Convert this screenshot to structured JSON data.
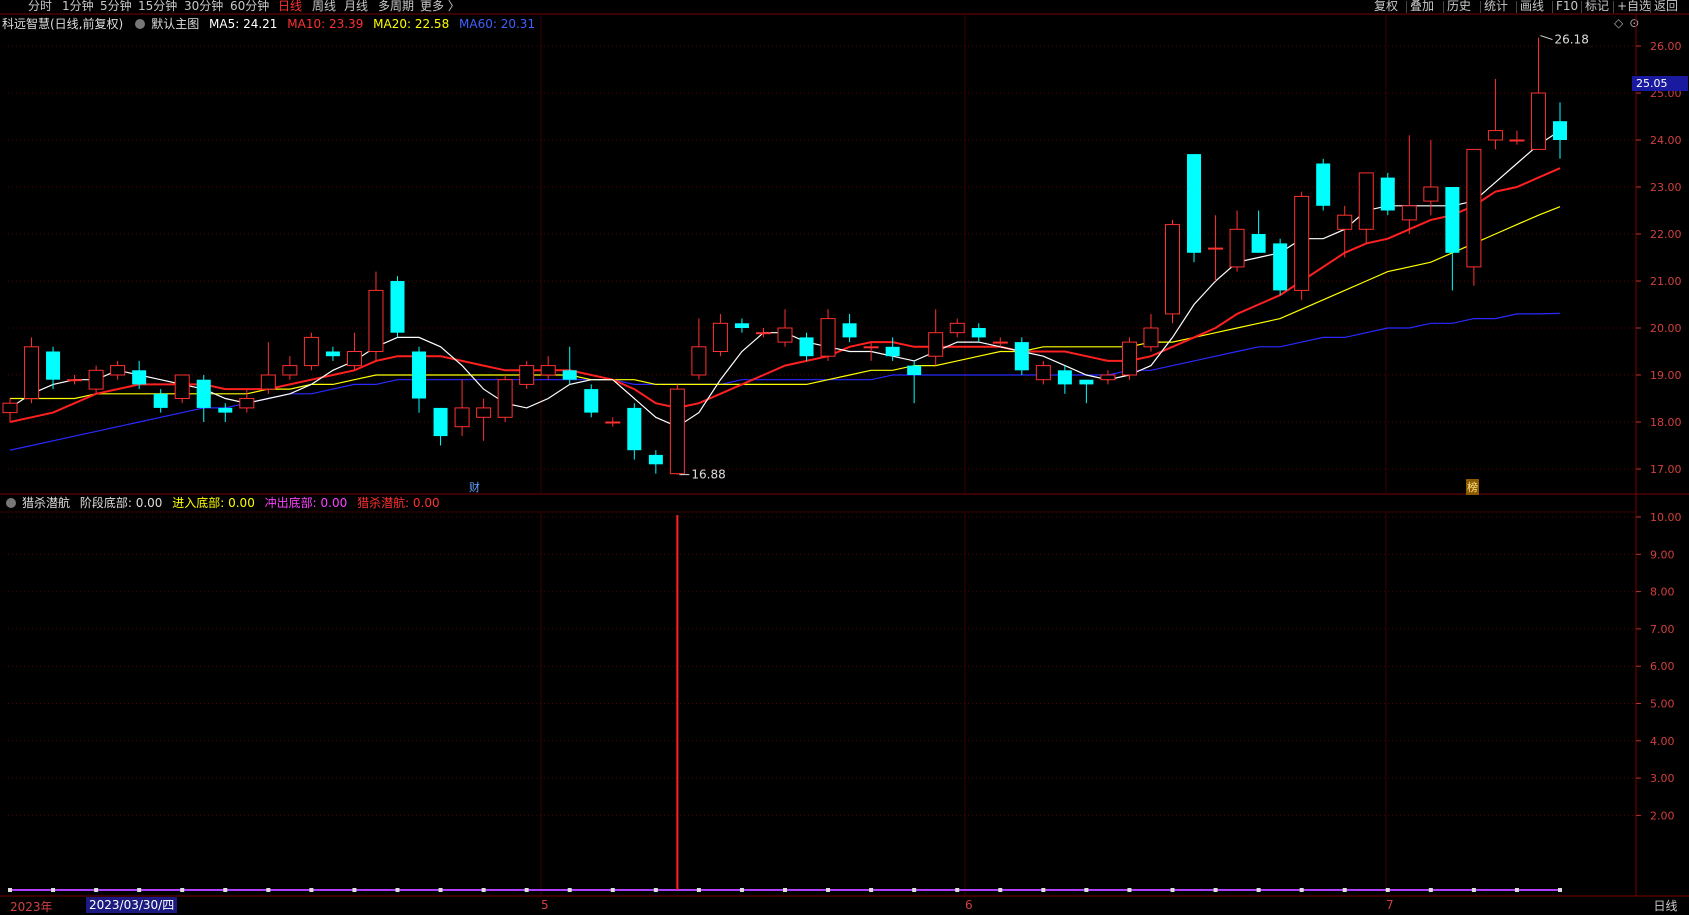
{
  "periods": [
    "分时",
    "1分钟",
    "5分钟",
    "15分钟",
    "30分钟",
    "60分钟",
    "日线",
    "周线",
    "月线",
    "多周期",
    "更多 〉"
  ],
  "active_period": "日线",
  "toolbar": [
    "复权",
    "叠加",
    "历史",
    "统计",
    "画线",
    "F10",
    "标记",
    "+自选",
    "返回"
  ],
  "window_icons": [
    "◇",
    "⊙"
  ],
  "main_legend": {
    "stock": "科远智慧(日线,前复权)",
    "template": "默认主图",
    "ma5": "MA5: 24.21",
    "ma10": "MA10: 23.39",
    "ma20": "MA20: 22.58",
    "ma60": "MA60: 20.31"
  },
  "sub_legend": {
    "name": "猎杀潜航",
    "stage": "阶段底部: 0.00",
    "enter": "进入底部: 0.00",
    "out": "冲出底部: 0.00",
    "hunt": "猎杀潜航: 0.00"
  },
  "current_price": "25.05",
  "high_label": "26.18",
  "low_label": "16.88",
  "markers": {
    "cai": "财",
    "bang": "榜"
  },
  "dates": {
    "year": "2023年",
    "selected": "2023/03/30/四",
    "m5": "5",
    "m6": "6",
    "m7": "7"
  },
  "bottom_tab": "日线",
  "colors": {
    "up": "#ff3030",
    "down": "#00ffff",
    "ma5": "#ffffff",
    "ma10": "#ff2020",
    "ma20": "#ffff00",
    "ma60": "#2a2aff",
    "grid": "#7a0000",
    "purple": "#b040ff"
  },
  "chart_data": {
    "type": "candlestick",
    "price_axis": {
      "ticks": [
        "26.00",
        "25.00",
        "24.00",
        "23.00",
        "22.00",
        "21.00",
        "20.00",
        "19.00",
        "18.00",
        "17.00"
      ]
    },
    "indicator_axis": {
      "ticks": [
        "10.00",
        "9.00",
        "8.00",
        "7.00",
        "6.00",
        "5.00",
        "4.00",
        "3.00",
        "2.00"
      ]
    },
    "candles": [
      {
        "o": 18.2,
        "h": 18.5,
        "l": 18.0,
        "c": 18.4
      },
      {
        "o": 18.5,
        "h": 19.8,
        "l": 18.4,
        "c": 19.6
      },
      {
        "o": 19.5,
        "h": 19.6,
        "l": 18.7,
        "c": 18.9
      },
      {
        "o": 18.9,
        "h": 19.0,
        "l": 18.8,
        "c": 18.9
      },
      {
        "o": 18.7,
        "h": 19.2,
        "l": 18.6,
        "c": 19.1
      },
      {
        "o": 19.0,
        "h": 19.3,
        "l": 18.9,
        "c": 19.2
      },
      {
        "o": 19.1,
        "h": 19.3,
        "l": 18.7,
        "c": 18.8
      },
      {
        "o": 18.6,
        "h": 18.7,
        "l": 18.2,
        "c": 18.3
      },
      {
        "o": 18.5,
        "h": 19.0,
        "l": 18.4,
        "c": 19.0
      },
      {
        "o": 18.9,
        "h": 19.0,
        "l": 18.0,
        "c": 18.3
      },
      {
        "o": 18.3,
        "h": 18.4,
        "l": 18.0,
        "c": 18.2
      },
      {
        "o": 18.3,
        "h": 18.7,
        "l": 18.2,
        "c": 18.5
      },
      {
        "o": 18.7,
        "h": 19.7,
        "l": 18.6,
        "c": 19.0
      },
      {
        "o": 19.0,
        "h": 19.4,
        "l": 18.9,
        "c": 19.2
      },
      {
        "o": 19.2,
        "h": 19.9,
        "l": 19.1,
        "c": 19.8
      },
      {
        "o": 19.5,
        "h": 19.6,
        "l": 19.3,
        "c": 19.4
      },
      {
        "o": 19.2,
        "h": 19.9,
        "l": 19.1,
        "c": 19.5
      },
      {
        "o": 19.5,
        "h": 21.2,
        "l": 19.3,
        "c": 20.8
      },
      {
        "o": 21.0,
        "h": 21.1,
        "l": 19.8,
        "c": 19.9
      },
      {
        "o": 19.5,
        "h": 19.6,
        "l": 18.2,
        "c": 18.5
      },
      {
        "o": 18.3,
        "h": 18.3,
        "l": 17.5,
        "c": 17.7
      },
      {
        "o": 17.9,
        "h": 18.9,
        "l": 17.7,
        "c": 18.3
      },
      {
        "o": 18.1,
        "h": 18.5,
        "l": 17.6,
        "c": 18.3
      },
      {
        "o": 18.1,
        "h": 19.0,
        "l": 18.0,
        "c": 18.9
      },
      {
        "o": 18.8,
        "h": 19.3,
        "l": 18.7,
        "c": 19.2
      },
      {
        "o": 19.0,
        "h": 19.4,
        "l": 18.9,
        "c": 19.2
      },
      {
        "o": 19.1,
        "h": 19.6,
        "l": 18.8,
        "c": 18.9
      },
      {
        "o": 18.7,
        "h": 18.8,
        "l": 18.1,
        "c": 18.2
      },
      {
        "o": 18.0,
        "h": 18.1,
        "l": 17.9,
        "c": 18.0
      },
      {
        "o": 18.3,
        "h": 18.4,
        "l": 17.2,
        "c": 17.4
      },
      {
        "o": 17.3,
        "h": 17.4,
        "l": 16.9,
        "c": 17.1
      },
      {
        "o": 16.9,
        "h": 18.8,
        "l": 16.88,
        "c": 18.7
      },
      {
        "o": 19.0,
        "h": 20.2,
        "l": 18.9,
        "c": 19.6
      },
      {
        "o": 19.5,
        "h": 20.3,
        "l": 19.4,
        "c": 20.1
      },
      {
        "o": 20.1,
        "h": 20.2,
        "l": 19.9,
        "c": 20.0
      },
      {
        "o": 19.9,
        "h": 20.0,
        "l": 19.8,
        "c": 19.9
      },
      {
        "o": 19.7,
        "h": 20.4,
        "l": 19.6,
        "c": 20.0
      },
      {
        "o": 19.8,
        "h": 19.9,
        "l": 19.3,
        "c": 19.4
      },
      {
        "o": 19.4,
        "h": 20.4,
        "l": 19.3,
        "c": 20.2
      },
      {
        "o": 20.1,
        "h": 20.3,
        "l": 19.7,
        "c": 19.8
      },
      {
        "o": 19.6,
        "h": 19.7,
        "l": 19.3,
        "c": 19.6
      },
      {
        "o": 19.6,
        "h": 19.8,
        "l": 19.3,
        "c": 19.4
      },
      {
        "o": 19.2,
        "h": 19.3,
        "l": 18.4,
        "c": 19.0
      },
      {
        "o": 19.4,
        "h": 20.4,
        "l": 19.2,
        "c": 19.9
      },
      {
        "o": 19.9,
        "h": 20.2,
        "l": 19.8,
        "c": 20.1
      },
      {
        "o": 20.0,
        "h": 20.1,
        "l": 19.7,
        "c": 19.8
      },
      {
        "o": 19.7,
        "h": 19.8,
        "l": 19.6,
        "c": 19.7
      },
      {
        "o": 19.7,
        "h": 19.8,
        "l": 19.0,
        "c": 19.1
      },
      {
        "o": 18.9,
        "h": 19.3,
        "l": 18.8,
        "c": 19.2
      },
      {
        "o": 19.1,
        "h": 19.2,
        "l": 18.6,
        "c": 18.8
      },
      {
        "o": 18.9,
        "h": 18.9,
        "l": 18.4,
        "c": 18.8
      },
      {
        "o": 18.9,
        "h": 19.1,
        "l": 18.8,
        "c": 19.0
      },
      {
        "o": 19.0,
        "h": 19.8,
        "l": 18.9,
        "c": 19.7
      },
      {
        "o": 19.6,
        "h": 20.3,
        "l": 19.5,
        "c": 20.0
      },
      {
        "o": 20.3,
        "h": 22.3,
        "l": 20.1,
        "c": 22.2
      },
      {
        "o": 23.7,
        "h": 23.7,
        "l": 21.4,
        "c": 21.6
      },
      {
        "o": 21.7,
        "h": 22.4,
        "l": 21.0,
        "c": 21.7
      },
      {
        "o": 21.3,
        "h": 22.5,
        "l": 21.2,
        "c": 22.1
      },
      {
        "o": 22.0,
        "h": 22.5,
        "l": 21.6,
        "c": 21.6
      },
      {
        "o": 21.8,
        "h": 21.9,
        "l": 20.7,
        "c": 20.8
      },
      {
        "o": 20.8,
        "h": 22.9,
        "l": 20.6,
        "c": 22.8
      },
      {
        "o": 23.5,
        "h": 23.6,
        "l": 22.5,
        "c": 22.6
      },
      {
        "o": 22.1,
        "h": 22.6,
        "l": 21.5,
        "c": 22.4
      },
      {
        "o": 22.1,
        "h": 23.3,
        "l": 21.8,
        "c": 23.3
      },
      {
        "o": 23.2,
        "h": 23.3,
        "l": 22.4,
        "c": 22.5
      },
      {
        "o": 22.3,
        "h": 24.1,
        "l": 22.0,
        "c": 22.6
      },
      {
        "o": 22.7,
        "h": 24.0,
        "l": 22.4,
        "c": 23.0
      },
      {
        "o": 23.0,
        "h": 23.0,
        "l": 20.8,
        "c": 21.6
      },
      {
        "o": 21.3,
        "h": 23.8,
        "l": 20.9,
        "c": 23.8
      },
      {
        "o": 24.0,
        "h": 25.3,
        "l": 23.8,
        "c": 24.2
      },
      {
        "o": 24.0,
        "h": 24.2,
        "l": 23.9,
        "c": 24.0
      },
      {
        "o": 23.8,
        "h": 26.18,
        "l": 23.8,
        "c": 25.0
      },
      {
        "o": 24.4,
        "h": 24.8,
        "l": 23.6,
        "c": 24.0
      }
    ],
    "ma5": [
      18.3,
      18.6,
      18.8,
      18.9,
      18.9,
      19.1,
      19.0,
      18.9,
      18.8,
      18.7,
      18.5,
      18.4,
      18.5,
      18.6,
      18.8,
      19.1,
      19.3,
      19.6,
      19.8,
      19.8,
      19.6,
      19.2,
      18.7,
      18.4,
      18.3,
      18.5,
      18.8,
      18.9,
      18.9,
      18.5,
      18.1,
      17.9,
      18.2,
      18.9,
      19.5,
      19.9,
      19.9,
      19.7,
      19.6,
      19.5,
      19.5,
      19.4,
      19.3,
      19.5,
      19.7,
      19.7,
      19.6,
      19.5,
      19.4,
      19.2,
      19.0,
      18.9,
      19.0,
      19.2,
      19.8,
      20.5,
      21.0,
      21.4,
      21.5,
      21.6,
      21.9,
      21.9,
      22.1,
      22.5,
      22.6,
      22.6,
      22.6,
      22.6,
      22.7,
      23.1,
      23.5,
      23.9,
      24.2
    ],
    "ma10": [
      18.0,
      18.1,
      18.2,
      18.4,
      18.6,
      18.7,
      18.8,
      18.8,
      18.8,
      18.8,
      18.7,
      18.7,
      18.7,
      18.8,
      18.9,
      19.0,
      19.1,
      19.3,
      19.4,
      19.4,
      19.4,
      19.3,
      19.2,
      19.1,
      19.1,
      19.1,
      19.1,
      19.0,
      18.9,
      18.7,
      18.4,
      18.3,
      18.4,
      18.6,
      18.8,
      19.0,
      19.2,
      19.3,
      19.4,
      19.6,
      19.7,
      19.7,
      19.6,
      19.6,
      19.6,
      19.6,
      19.6,
      19.5,
      19.5,
      19.5,
      19.4,
      19.3,
      19.3,
      19.4,
      19.6,
      19.8,
      20.0,
      20.3,
      20.5,
      20.7,
      21.0,
      21.3,
      21.6,
      21.8,
      21.9,
      22.1,
      22.3,
      22.4,
      22.6,
      22.9,
      23.0,
      23.2,
      23.4
    ],
    "ma20": [
      18.5,
      18.5,
      18.5,
      18.5,
      18.6,
      18.6,
      18.6,
      18.6,
      18.6,
      18.6,
      18.6,
      18.6,
      18.7,
      18.7,
      18.8,
      18.8,
      18.9,
      19.0,
      19.0,
      19.0,
      19.0,
      19.0,
      19.0,
      19.0,
      19.0,
      19.0,
      19.0,
      18.9,
      18.9,
      18.9,
      18.8,
      18.8,
      18.8,
      18.8,
      18.8,
      18.8,
      18.8,
      18.8,
      18.9,
      19.0,
      19.1,
      19.1,
      19.2,
      19.2,
      19.3,
      19.4,
      19.5,
      19.5,
      19.6,
      19.6,
      19.6,
      19.6,
      19.6,
      19.7,
      19.7,
      19.8,
      19.9,
      20.0,
      20.1,
      20.2,
      20.4,
      20.6,
      20.8,
      21.0,
      21.2,
      21.3,
      21.4,
      21.6,
      21.8,
      22.0,
      22.2,
      22.4,
      22.58
    ],
    "ma60": [
      17.4,
      17.5,
      17.6,
      17.7,
      17.8,
      17.9,
      18.0,
      18.1,
      18.2,
      18.3,
      18.3,
      18.4,
      18.5,
      18.6,
      18.6,
      18.7,
      18.8,
      18.8,
      18.9,
      18.9,
      18.9,
      18.9,
      18.9,
      18.9,
      18.9,
      18.9,
      18.9,
      18.9,
      18.9,
      18.8,
      18.8,
      18.8,
      18.8,
      18.8,
      18.9,
      18.9,
      18.9,
      18.9,
      18.9,
      18.9,
      18.9,
      19.0,
      19.0,
      19.0,
      19.0,
      19.0,
      19.0,
      19.0,
      19.0,
      19.0,
      19.0,
      19.0,
      19.1,
      19.1,
      19.2,
      19.3,
      19.4,
      19.5,
      19.6,
      19.6,
      19.7,
      19.8,
      19.8,
      19.9,
      20.0,
      20.0,
      20.1,
      20.1,
      20.2,
      20.2,
      20.3,
      20.3,
      20.31
    ],
    "indicator_spike_index": 31,
    "indicator_spike_value": 10.0
  }
}
